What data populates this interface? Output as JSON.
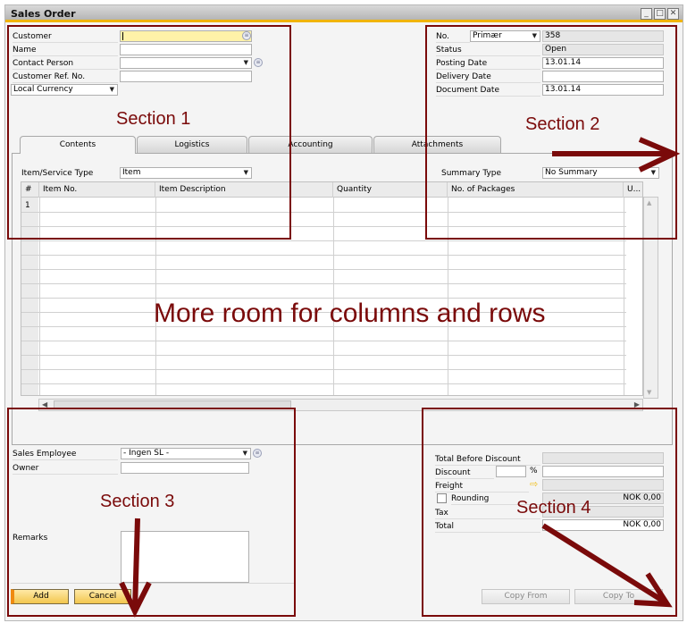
{
  "window": {
    "title": "Sales Order",
    "controls": [
      "minimize",
      "maximize",
      "close"
    ]
  },
  "header_left": {
    "customer": {
      "label": "Customer",
      "value": ""
    },
    "name": {
      "label": "Name",
      "value": ""
    },
    "contact_person": {
      "label": "Contact Person",
      "value": ""
    },
    "customer_ref_no": {
      "label": "Customer Ref. No.",
      "value": ""
    },
    "currency": {
      "value": "Local Currency"
    }
  },
  "header_right": {
    "no": {
      "label": "No.",
      "series": "Primær",
      "value": "358"
    },
    "status": {
      "label": "Status",
      "value": "Open"
    },
    "posting_date": {
      "label": "Posting Date",
      "value": "13.01.14"
    },
    "delivery_date": {
      "label": "Delivery Date",
      "value": ""
    },
    "document_date": {
      "label": "Document Date",
      "value": "13.01.14"
    }
  },
  "tabs": [
    {
      "label": "Contents",
      "active": true
    },
    {
      "label": "Logistics",
      "active": false
    },
    {
      "label": "Accounting",
      "active": false
    },
    {
      "label": "Attachments",
      "active": false
    }
  ],
  "contents": {
    "item_service_type": {
      "label": "Item/Service Type",
      "value": "Item"
    },
    "summary_type": {
      "label": "Summary Type",
      "value": "No Summary"
    },
    "grid": {
      "columns": [
        "#",
        "Item No.",
        "Item Description",
        "Quantity",
        "No. of Packages",
        "U..."
      ],
      "rows": [
        [
          "1",
          "",
          "",
          "",
          "",
          ""
        ]
      ]
    }
  },
  "footer_left": {
    "sales_employee": {
      "label": "Sales Employee",
      "value": "- Ingen SL -"
    },
    "owner": {
      "label": "Owner",
      "value": ""
    },
    "remarks": {
      "label": "Remarks",
      "value": ""
    }
  },
  "footer_right": {
    "total_before_discount": {
      "label": "Total Before Discount",
      "value": ""
    },
    "discount": {
      "label": "Discount",
      "percent": "",
      "percent_sign": "%",
      "value": ""
    },
    "freight": {
      "label": "Freight",
      "value": ""
    },
    "rounding": {
      "label": "Rounding",
      "checked": false,
      "value": "NOK 0,00"
    },
    "tax": {
      "label": "Tax",
      "value": ""
    },
    "total": {
      "label": "Total",
      "value": "NOK 0,00"
    }
  },
  "buttons": {
    "add": "Add",
    "cancel": "Cancel",
    "copy_from": "Copy From",
    "copy_to": "Copy To"
  },
  "annotations": {
    "section1": "Section 1",
    "section2": "Section 2",
    "section3": "Section 3",
    "section4": "Section 4",
    "center": "More room for columns and rows",
    "color": "#7a0a0a"
  }
}
